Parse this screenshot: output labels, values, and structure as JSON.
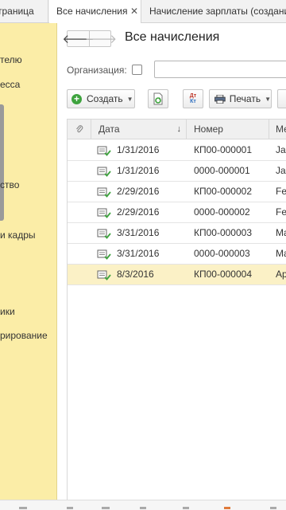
{
  "tabs": [
    {
      "label": "страница"
    },
    {
      "label": "Все начисления",
      "active": true
    },
    {
      "label": "Начисление зарплаты (создани"
    }
  ],
  "sidebar": {
    "background": "#fbeda7",
    "items": [
      {
        "label": "телю"
      },
      {
        "label": "есса"
      },
      {
        "label": "ство"
      },
      {
        "label": "и кадры"
      },
      {
        "label": "ики"
      },
      {
        "label": "рирование"
      }
    ]
  },
  "header": {
    "title": "Все начисления"
  },
  "filter": {
    "organization_label": "Организация:",
    "organization_checked": false,
    "organization_value": ""
  },
  "toolbar": {
    "create_label": "Создать",
    "dt_label": "Дт",
    "kt_label": "Кт",
    "print_label": "Печать"
  },
  "table": {
    "columns": [
      {
        "label": "Дата"
      },
      {
        "label": "Номер"
      },
      {
        "label": "Ме"
      }
    ],
    "sort_indicator": "↓",
    "rows": [
      {
        "date": "1/31/2016",
        "number": "КП00-000001",
        "month": "Ja"
      },
      {
        "date": "1/31/2016",
        "number": "0000-000001",
        "month": "Ja"
      },
      {
        "date": "2/29/2016",
        "number": "КП00-000002",
        "month": "Fe"
      },
      {
        "date": "2/29/2016",
        "number": "0000-000002",
        "month": "Fe"
      },
      {
        "date": "3/31/2016",
        "number": "КП00-000003",
        "month": "Ma"
      },
      {
        "date": "3/31/2016",
        "number": "0000-000003",
        "month": "Ma"
      },
      {
        "date": "8/3/2016",
        "number": "КП00-000004",
        "month": "Ap",
        "selected": true
      }
    ]
  },
  "colors": {
    "selected_row": "#fbf1c6",
    "accent_green": "#3ea33e"
  }
}
